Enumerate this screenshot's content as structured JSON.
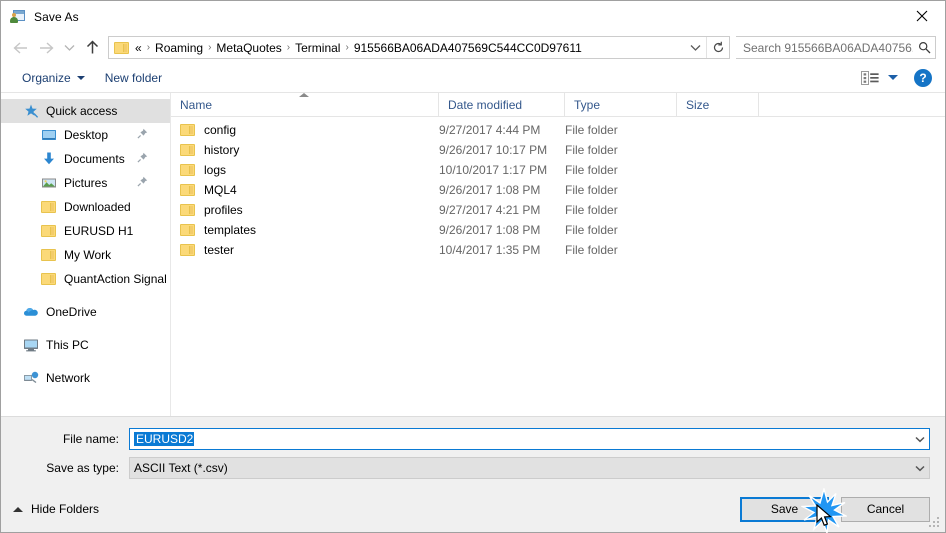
{
  "window": {
    "title": "Save As",
    "icon": "save-as-app-icon",
    "close_label": "×"
  },
  "nav": {
    "back_icon": "arrow-left-icon",
    "forward_icon": "arrow-right-icon",
    "recent_icon": "chevron-down-icon",
    "up_icon": "arrow-up-icon",
    "folder_icon": "folder-icon",
    "breadcrumb_head": "«",
    "breadcrumbs": [
      "Roaming",
      "MetaQuotes",
      "Terminal",
      "915566BA06ADA407569C544CC0D97611"
    ],
    "separator": "›",
    "dropdown_icon": "chevron-down-icon",
    "refresh_icon": "refresh-icon"
  },
  "search": {
    "placeholder": "Search 915566BA06ADA40756...",
    "icon": "search-icon"
  },
  "toolbar": {
    "organize_label": "Organize",
    "new_folder_label": "New folder",
    "view_icon": "view-options-icon",
    "view_caret_icon": "chevron-down-icon",
    "help_label": "?",
    "help_icon": "help-icon"
  },
  "sidebar": {
    "groups": [
      {
        "root": {
          "label": "Quick access",
          "icon": "star-pin-icon",
          "selected": true
        },
        "items": [
          {
            "label": "Desktop",
            "icon": "desktop-icon",
            "pinned": true
          },
          {
            "label": "Documents",
            "icon": "documents-download-icon",
            "pinned": true
          },
          {
            "label": "Pictures",
            "icon": "pictures-icon",
            "pinned": true
          },
          {
            "label": "Downloaded",
            "icon": "folder-icon",
            "pinned": false
          },
          {
            "label": "EURUSD H1",
            "icon": "folder-icon",
            "pinned": false
          },
          {
            "label": "My Work",
            "icon": "folder-icon",
            "pinned": false
          },
          {
            "label": "QuantAction Signal",
            "icon": "folder-icon",
            "pinned": false
          }
        ]
      },
      {
        "root": {
          "label": "OneDrive",
          "icon": "onedrive-cloud-icon",
          "selected": false
        },
        "items": []
      },
      {
        "root": {
          "label": "This PC",
          "icon": "this-pc-icon",
          "selected": false
        },
        "items": []
      },
      {
        "root": {
          "label": "Network",
          "icon": "network-icon",
          "selected": false
        },
        "items": []
      }
    ]
  },
  "filelist": {
    "columns": [
      "Name",
      "Date modified",
      "Type",
      "Size"
    ],
    "sort_column": "Name",
    "sort_direction": "ascending",
    "rows": [
      {
        "name": "config",
        "date": "9/27/2017 4:44 PM",
        "type": "File folder",
        "size": ""
      },
      {
        "name": "history",
        "date": "9/26/2017 10:17 PM",
        "type": "File folder",
        "size": ""
      },
      {
        "name": "logs",
        "date": "10/10/2017 1:17 PM",
        "type": "File folder",
        "size": ""
      },
      {
        "name": "MQL4",
        "date": "9/26/2017 1:08 PM",
        "type": "File folder",
        "size": ""
      },
      {
        "name": "profiles",
        "date": "9/27/2017 4:21 PM",
        "type": "File folder",
        "size": ""
      },
      {
        "name": "templates",
        "date": "9/26/2017 1:08 PM",
        "type": "File folder",
        "size": ""
      },
      {
        "name": "tester",
        "date": "10/4/2017 1:35 PM",
        "type": "File folder",
        "size": ""
      }
    ]
  },
  "form": {
    "filename_label": "File name:",
    "filename_value": "EURUSD2",
    "filename_selected": true,
    "filetype_label": "Save as type:",
    "filetype_value": "ASCII Text (*.csv)",
    "dropdown_icon": "chevron-down-icon"
  },
  "footer": {
    "hide_folders_label": "Hide Folders",
    "hide_folders_icon": "chevron-up-icon",
    "save_label": "Save",
    "cancel_label": "Cancel",
    "default_button": "Save"
  },
  "colors": {
    "accent": "#0a7ad4",
    "selection": "#0a7ad4",
    "header_text": "#34588c",
    "toolbar_text": "#1c3f72",
    "folder_yellow": "#fbd978",
    "help_blue": "#1574c6",
    "window_bg": "#f0f0f0"
  }
}
